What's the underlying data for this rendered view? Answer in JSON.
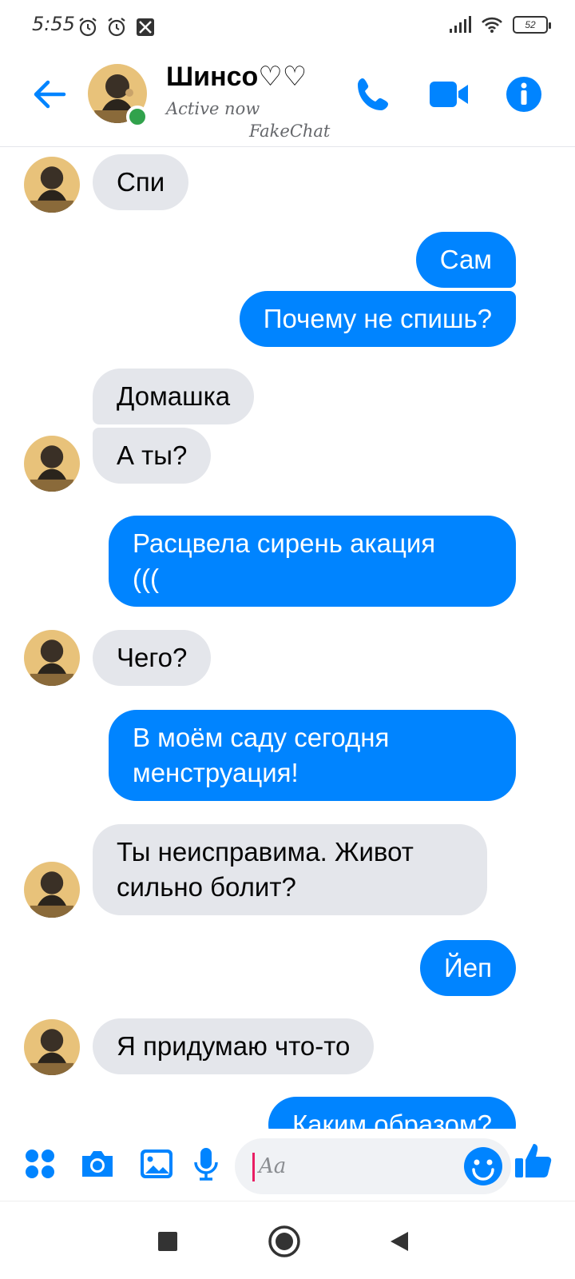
{
  "status_bar": {
    "time": "5:55",
    "battery": "52",
    "icons": [
      "alarm-icon",
      "alarm-icon",
      "no-sim-icon",
      "signal-icon",
      "wifi-icon",
      "battery-icon"
    ]
  },
  "header": {
    "contact_name": "Шинсо♡♡",
    "status": "Active now",
    "watermark": "FakeChat",
    "accent_color": "#0084ff",
    "online_color": "#31a24c"
  },
  "messages": [
    {
      "side": "in",
      "text": "Спи",
      "avatar": true
    },
    {
      "side": "out",
      "text": "Сам"
    },
    {
      "side": "out",
      "text": "Почему не спишь?"
    },
    {
      "side": "in",
      "text": "Домашка",
      "avatar": false
    },
    {
      "side": "in",
      "text": "А ты?",
      "avatar": true
    },
    {
      "side": "out",
      "text": "Расцвела сирень акация\n((("
    },
    {
      "side": "in",
      "text": "Чего?",
      "avatar": true
    },
    {
      "side": "out",
      "text": "В моём саду сегодня\nменструация!"
    },
    {
      "side": "in",
      "text": "Ты неисправима. Живот\nсильно болит?",
      "avatar": true
    },
    {
      "side": "out",
      "text": "Йеп"
    },
    {
      "side": "in",
      "text": "Я придумаю что-то",
      "avatar": true
    },
    {
      "side": "out",
      "text": "Каким образом?"
    }
  ],
  "composer": {
    "placeholder": "Aa",
    "icons": [
      "menu-dots-icon",
      "camera-icon",
      "gallery-icon",
      "microphone-icon",
      "emoji-icon",
      "thumbs-up-icon"
    ]
  },
  "colors": {
    "incoming_bubble": "#e4e6eb",
    "outgoing_bubble": "#0084ff"
  }
}
